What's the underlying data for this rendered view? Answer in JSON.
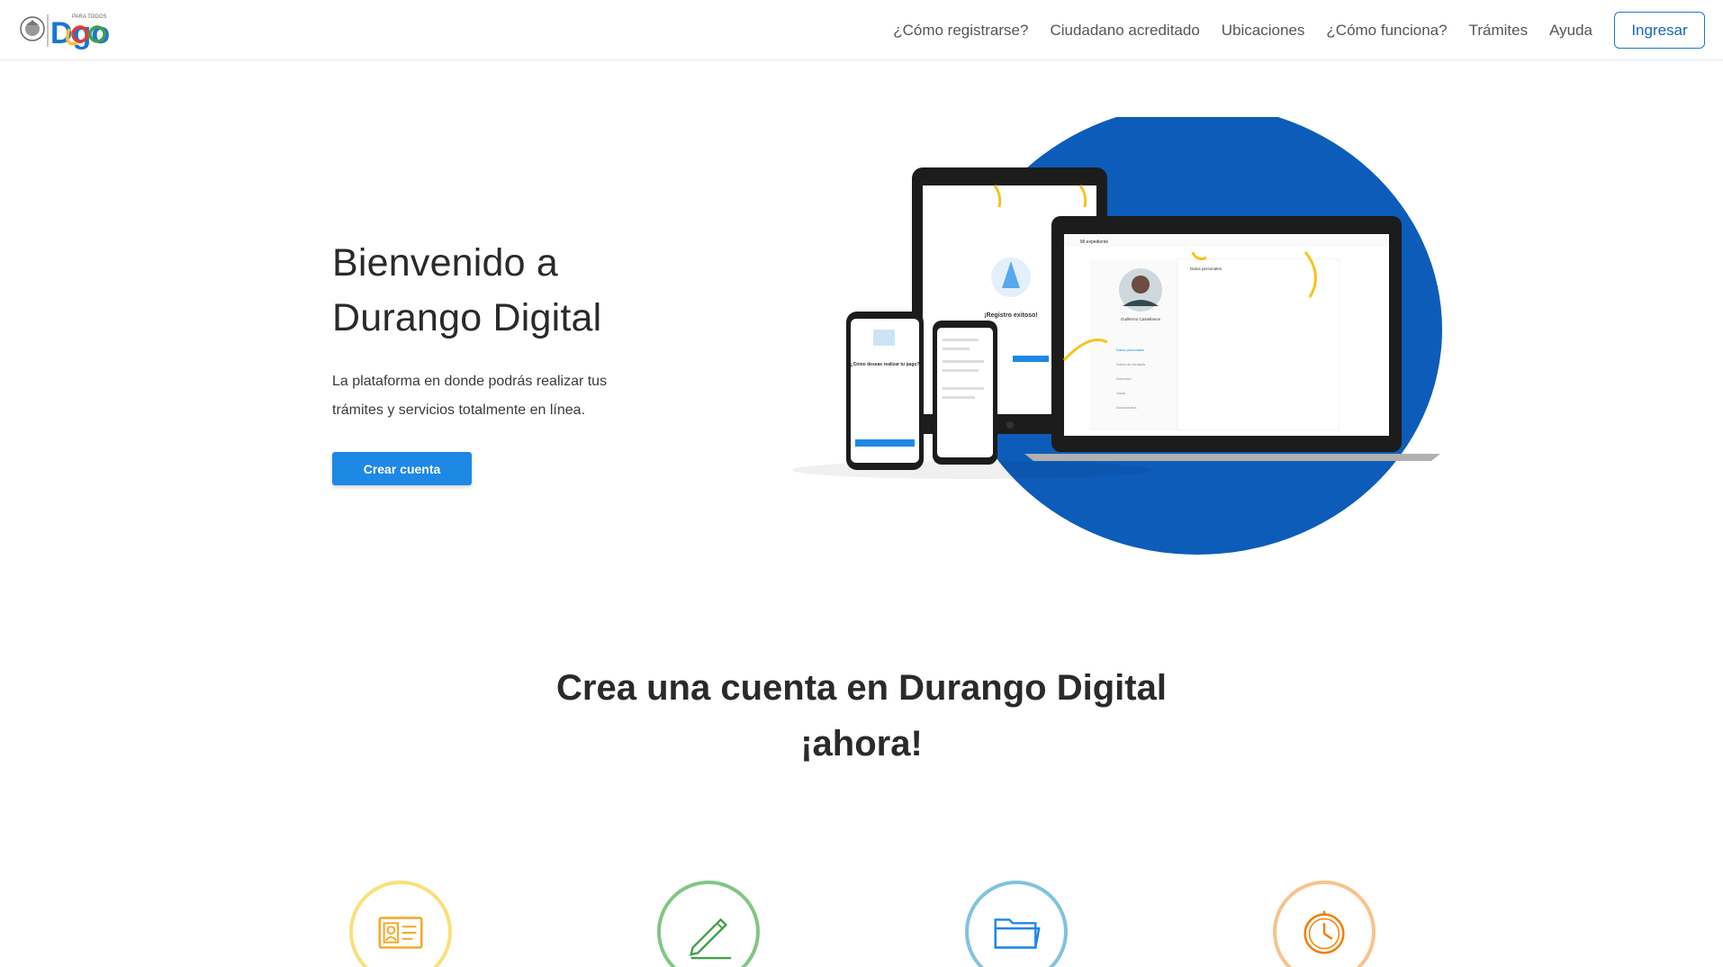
{
  "header": {
    "logo": {
      "text_small": "PARA TODOS",
      "text_big": "Dgo"
    },
    "nav": [
      {
        "label": "¿Cómo registrarse?"
      },
      {
        "label": "Ciudadano acreditado"
      },
      {
        "label": "Ubicaciones"
      },
      {
        "label": "¿Cómo funciona?"
      },
      {
        "label": "Trámites"
      },
      {
        "label": "Ayuda"
      }
    ],
    "login_label": "Ingresar"
  },
  "hero": {
    "title_line1": "Bienvenido a",
    "title_line2": "Durango Digital",
    "subtitle": "La plataforma en donde podrás realizar tus trámites y servicios totalmente en línea.",
    "cta_label": "Crear cuenta",
    "illustration": {
      "tablet_text": "¡Registro exitoso!",
      "phone_text": "¿Cómo deseas realizar tu pago?",
      "laptop_header": "Mi expediente",
      "laptop_user": "Guillermo Castellanos",
      "laptop_section": "Datos personales",
      "laptop_menu": [
        "Datos personales",
        "Datos de contacto",
        "Dirección",
        "Salud",
        "Documentos"
      ]
    }
  },
  "section": {
    "title_line1": "Crea una cuenta en Durango Digital",
    "title_line2": "¡ahora!"
  },
  "steps": [
    {
      "icon": "id-card-icon",
      "color": "#f9e07a"
    },
    {
      "icon": "pen-icon",
      "color": "#81c784"
    },
    {
      "icon": "folder-icon",
      "color": "#80c3de"
    },
    {
      "icon": "clock-icon",
      "color": "#f7c38c"
    }
  ],
  "colors": {
    "primary": "#1e88e5",
    "circle_blue": "#0d5cba",
    "accent_yellow": "#f5c518"
  }
}
